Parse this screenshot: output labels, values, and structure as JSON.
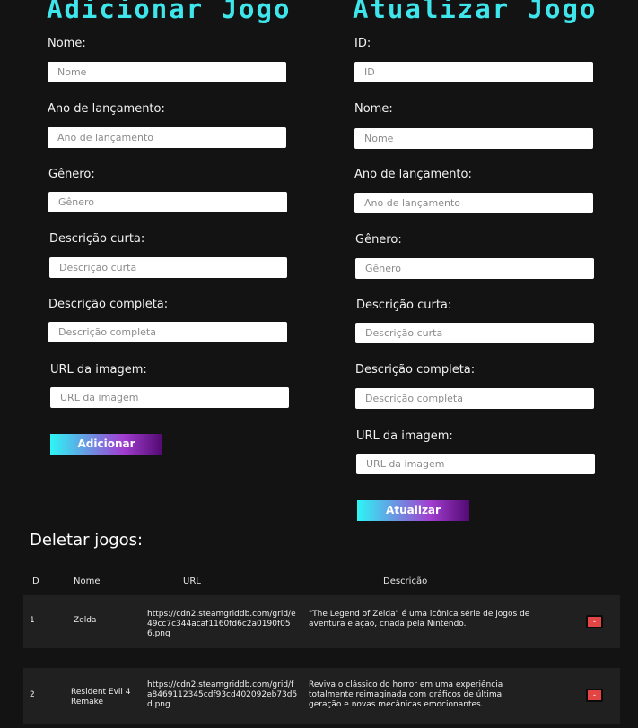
{
  "add_form": {
    "title": "Adicionar Jogo",
    "fields": [
      {
        "label": "Nome:",
        "placeholder": "Nome"
      },
      {
        "label": "Ano de lançamento:",
        "placeholder": "Ano de lançamento"
      },
      {
        "label": "Gênero:",
        "placeholder": "Gênero"
      },
      {
        "label": "Descrição curta:",
        "placeholder": "Descrição curta"
      },
      {
        "label": "Descrição completa:",
        "placeholder": "Descrição completa"
      },
      {
        "label": "URL da imagem:",
        "placeholder": "URL da imagem"
      }
    ],
    "submit_label": "Adicionar"
  },
  "update_form": {
    "title": "Atualizar Jogo",
    "fields": [
      {
        "label": "ID:",
        "placeholder": "ID"
      },
      {
        "label": "Nome:",
        "placeholder": "Nome"
      },
      {
        "label": "Ano de lançamento:",
        "placeholder": "Ano de lançamento"
      },
      {
        "label": "Gênero:",
        "placeholder": "Gênero"
      },
      {
        "label": "Descrição curta:",
        "placeholder": "Descrição curta"
      },
      {
        "label": "Descrição completa:",
        "placeholder": "Descrição completa"
      },
      {
        "label": "URL da imagem:",
        "placeholder": "URL da imagem"
      }
    ],
    "submit_label": "Atualizar"
  },
  "delete_section": {
    "title": "Deletar jogos:",
    "columns": [
      "ID",
      "Nome",
      "URL",
      "Descrição"
    ],
    "rows": [
      {
        "id": "1",
        "name": "Zelda",
        "url": "https://cdn2.steamgriddb.com/grid/e49cc7c344acaf1160fd6c2a0190f056.png",
        "description": "\"The Legend of Zelda\" é uma icônica série de jogos de aventura e ação, criada pela Nintendo.",
        "delete_label": "-"
      },
      {
        "id": "2",
        "name": "Resident Evil 4 Remake",
        "url": "https://cdn2.steamgriddb.com/grid/fa8469112345cdf93cd402092eb73d5d.png",
        "description": "Reviva o clássico do horror em uma experiência totalmente reimaginada com gráficos de última geração e novas mecânicas emocionantes.",
        "delete_label": "-"
      }
    ]
  }
}
